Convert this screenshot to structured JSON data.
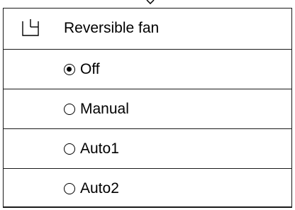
{
  "header": {
    "icon": "fan-indicator-icon",
    "label": "Reversible fan"
  },
  "options": [
    {
      "label": "Off",
      "selected": true
    },
    {
      "label": "Manual",
      "selected": false
    },
    {
      "label": "Auto1",
      "selected": false
    },
    {
      "label": "Auto2",
      "selected": false
    }
  ]
}
